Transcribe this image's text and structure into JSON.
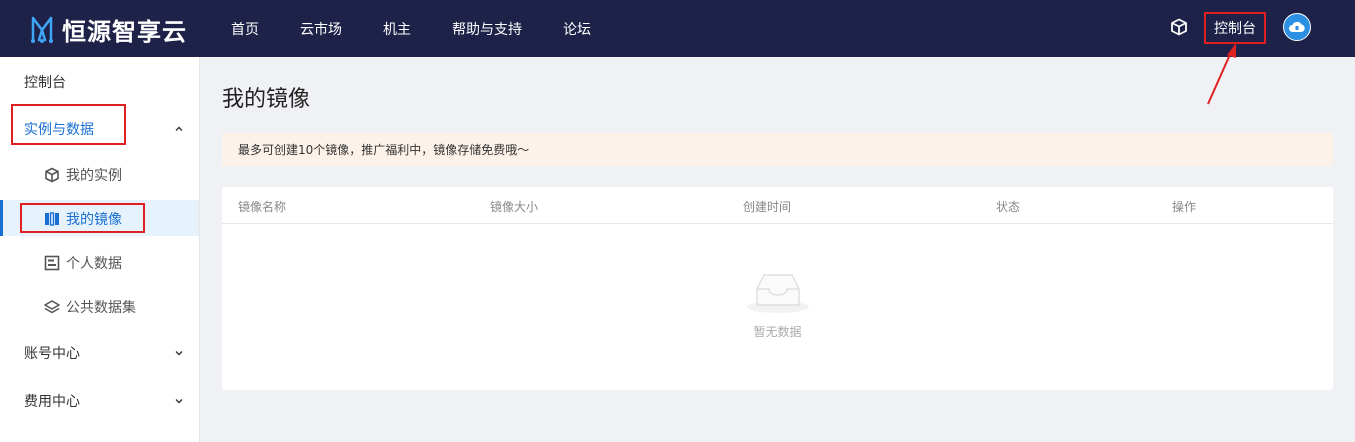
{
  "header": {
    "brand": "恒源智享云",
    "nav": [
      "首页",
      "云市场",
      "机主",
      "帮助与支持",
      "论坛"
    ],
    "console_label": "控制台"
  },
  "sidebar": {
    "top_label": "控制台",
    "groups": [
      {
        "label": "实例与数据",
        "expanded": true
      },
      {
        "label": "账号中心",
        "expanded": false
      },
      {
        "label": "费用中心",
        "expanded": false
      }
    ],
    "sub_items": [
      {
        "label": "我的实例",
        "icon": "cube-icon"
      },
      {
        "label": "我的镜像",
        "icon": "image-icon",
        "active": true
      },
      {
        "label": "个人数据",
        "icon": "data-icon"
      },
      {
        "label": "公共数据集",
        "icon": "layers-icon"
      }
    ]
  },
  "main": {
    "title": "我的镜像",
    "notice": "最多可创建10个镜像，推广福利中，镜像存储免费哦～",
    "table": {
      "columns": [
        "镜像名称",
        "镜像大小",
        "创建时间",
        "状态",
        "操作"
      ],
      "empty_text": "暂无数据"
    }
  },
  "colors": {
    "topbar": "#1e2148",
    "accent": "#1a6fd1",
    "highlight": "#e02020"
  }
}
